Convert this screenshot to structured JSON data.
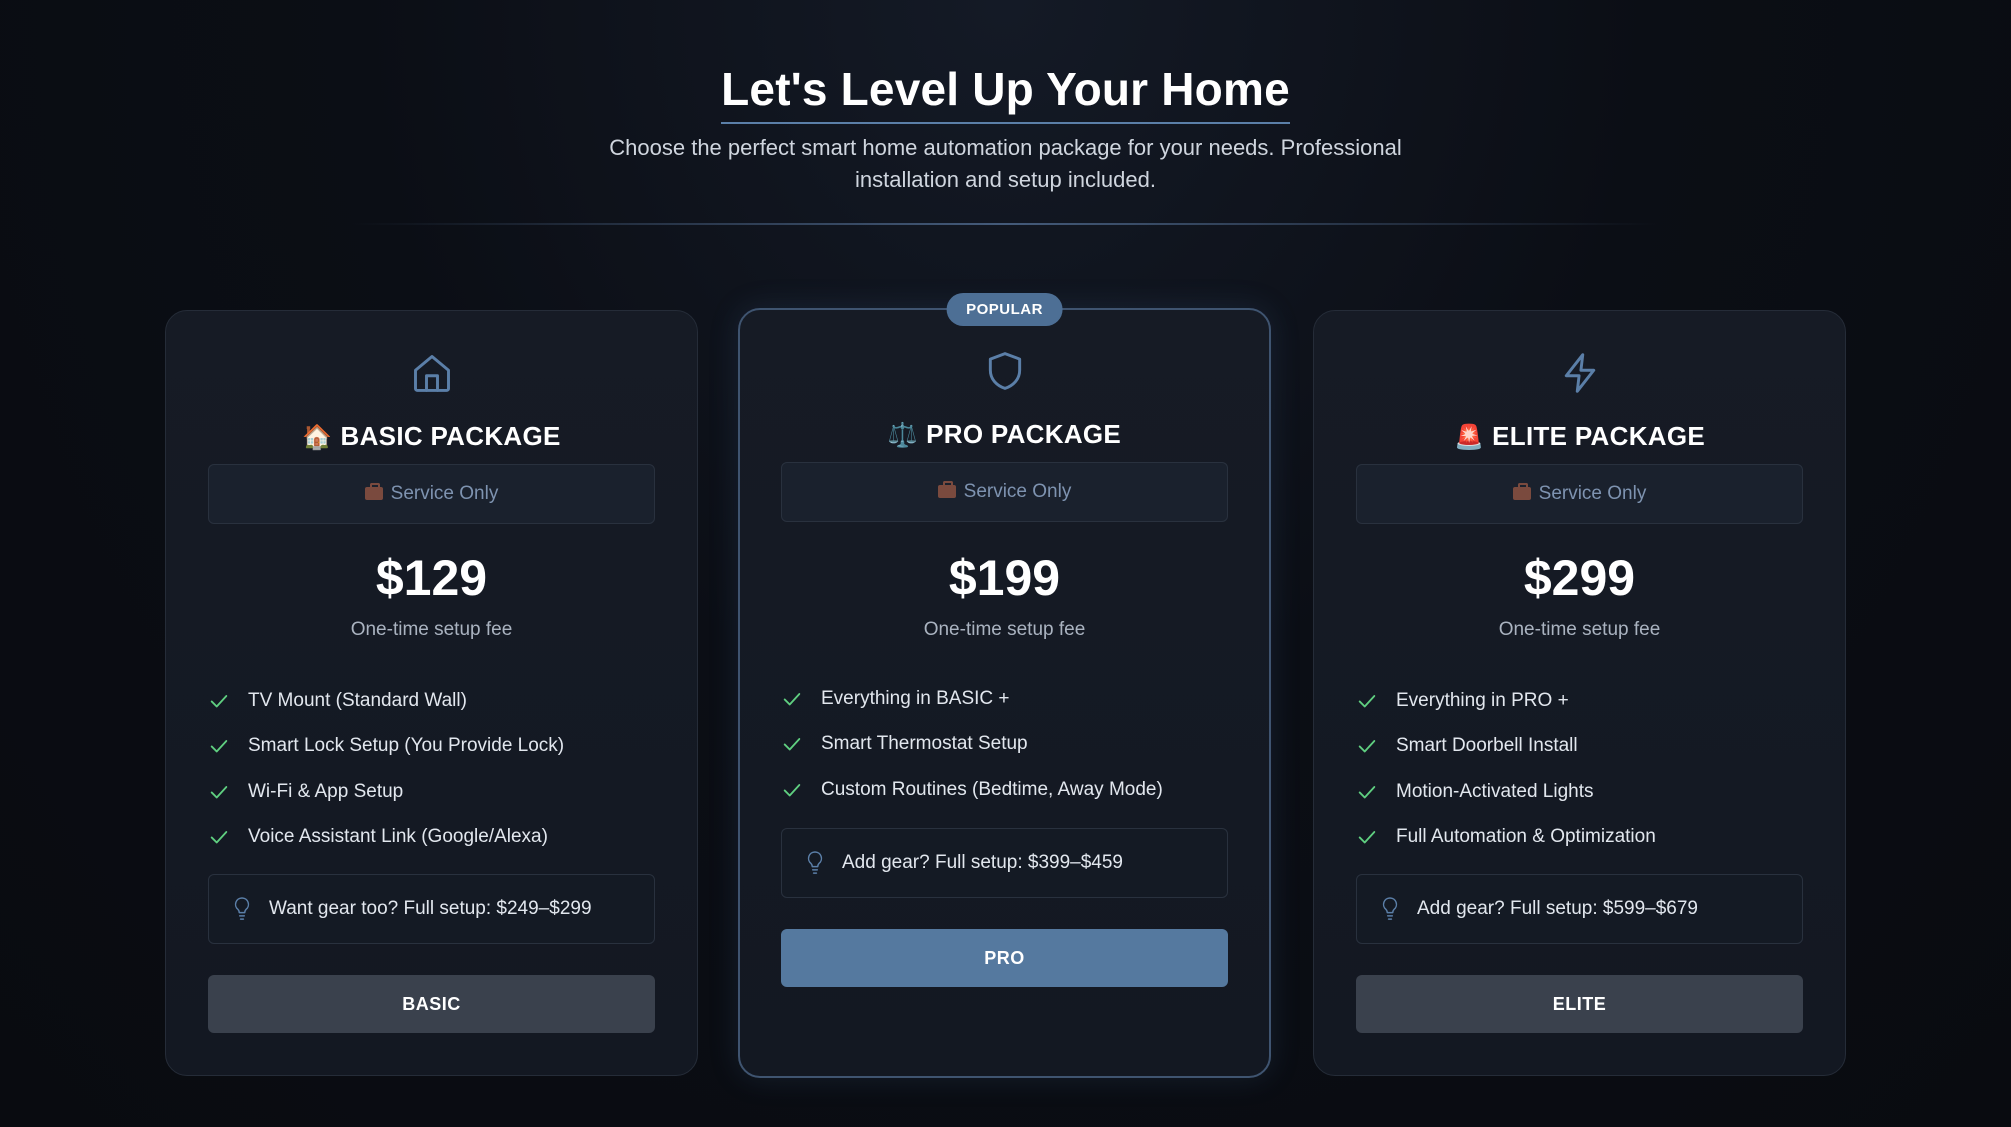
{
  "header": {
    "title": "Let's Level Up Your Home",
    "subtitle": "Choose the perfect smart home automation package for your needs. Professional installation and setup included."
  },
  "colors": {
    "background": "#0b0e15",
    "card": "#161b25",
    "accent": "#55799f",
    "check": "#5fcf80",
    "button_dark": "#3a414d"
  },
  "cards": [
    {
      "icon": "home-icon",
      "emoji": "🏠",
      "title": "BASIC PACKAGE",
      "service": "Service Only",
      "price": "$129",
      "price_note": "One-time setup fee",
      "features": [
        "TV Mount (Standard Wall)",
        "Smart Lock Setup (You Provide Lock)",
        "Wi-Fi & App Setup",
        "Voice Assistant Link (Google/Alexa)"
      ],
      "gear": "Want gear too? Full setup: $249–$299",
      "button": "BASIC"
    },
    {
      "badge": "POPULAR",
      "icon": "shield-icon",
      "emoji": "⚖️",
      "title": "PRO PACKAGE",
      "service": "Service Only",
      "price": "$199",
      "price_note": "One-time setup fee",
      "features": [
        "Everything in BASIC +",
        "Smart Thermostat Setup",
        "Custom Routines (Bedtime, Away Mode)"
      ],
      "gear": "Add gear? Full setup: $399–$459",
      "button": "PRO"
    },
    {
      "icon": "lightning-icon",
      "emoji": "🚨",
      "title": "ELITE PACKAGE",
      "service": "Service Only",
      "price": "$299",
      "price_note": "One-time setup fee",
      "features": [
        "Everything in PRO +",
        "Smart Doorbell Install",
        "Motion-Activated Lights",
        "Full Automation & Optimization"
      ],
      "gear": "Add gear? Full setup: $599–$679",
      "button": "ELITE"
    }
  ]
}
